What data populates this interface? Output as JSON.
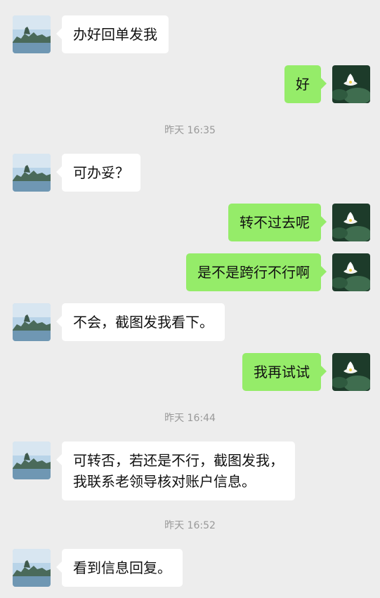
{
  "messages": [
    {
      "side": "left",
      "text": "办好回单发我"
    },
    {
      "side": "right",
      "text": "好"
    },
    {
      "type": "time",
      "text": "昨天 16:35"
    },
    {
      "side": "left",
      "text": "可办妥？"
    },
    {
      "side": "right",
      "text": "转不过去呢"
    },
    {
      "side": "right",
      "text": "是不是跨行不行啊"
    },
    {
      "side": "left",
      "text": "不会，截图发我看下。"
    },
    {
      "side": "right",
      "text": "我再试试"
    },
    {
      "type": "time",
      "text": "昨天 16:44"
    },
    {
      "side": "left",
      "text": "可转否，若还是不行，截图发我，\n我联系老领导核对账户信息。"
    },
    {
      "type": "time",
      "text": "昨天 16:52"
    },
    {
      "side": "left",
      "text": "看到信息回复。"
    }
  ],
  "colors": {
    "background": "#ededed",
    "sent_bubble": "#95ec69",
    "received_bubble": "#ffffff",
    "timestamp": "#999999"
  },
  "icons": {
    "contact_avatar": "landscape-avatar-icon",
    "self_avatar": "lotus-avatar-icon"
  }
}
